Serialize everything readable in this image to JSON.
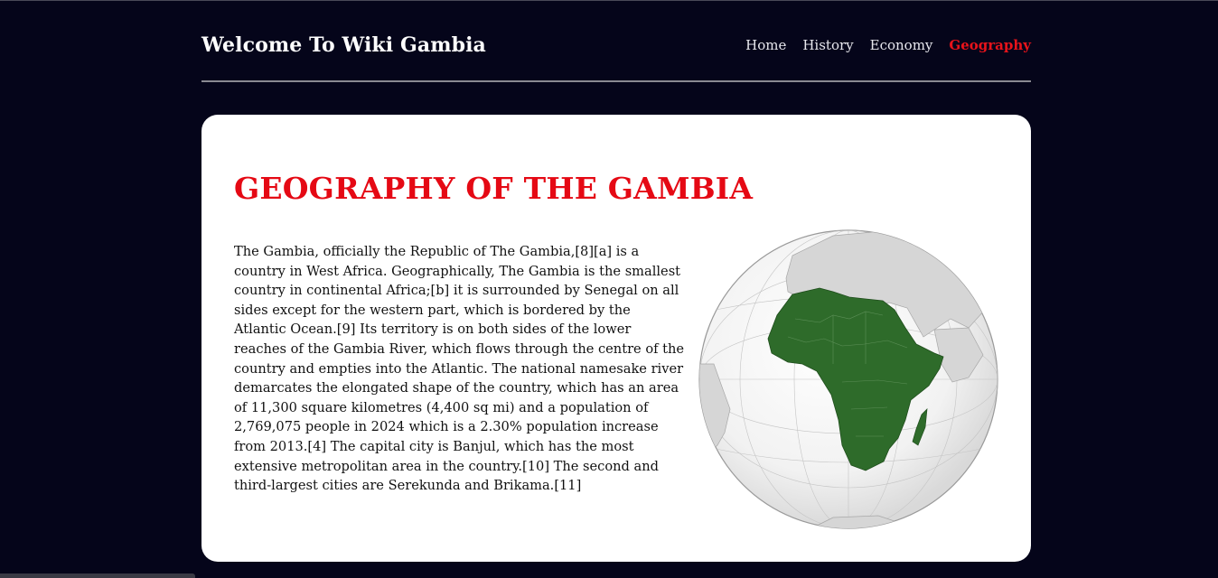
{
  "header": {
    "title": "Welcome To Wiki Gambia",
    "nav": [
      {
        "label": "Home",
        "active": false
      },
      {
        "label": "History",
        "active": false
      },
      {
        "label": "Economy",
        "active": false
      },
      {
        "label": "Geography",
        "active": true
      }
    ]
  },
  "main": {
    "heading": "GEOGRAPHY OF THE GAMBIA",
    "paragraph": "The Gambia, officially the Republic of The Gambia,[8][a] is a country in West Africa. Geographically, The Gambia is the smallest country in continental Africa;[b] it is surrounded by Senegal on all sides except for the western part, which is bordered by the Atlantic Ocean.[9] Its territory is on both sides of the lower reaches of the Gambia River, which flows through the centre of the country and empties into the Atlantic. The national namesake river demarcates the elongated shape of the country, which has an area of 11,300 square kilometres (4,400 sq mi) and a population of 2,769,075 people in 2024 which is a 2.30% population increase from 2013.[4] The capital city is Banjul, which has the most extensive metropolitan area in the country.[10] The second and third-largest cities are Serekunda and Brikama.[11]",
    "image": "orthographic-globe-africa-highlighted"
  },
  "colors": {
    "background": "#05051a",
    "accent": "#e50914",
    "highlight_land": "#2e6b2a",
    "other_land": "#d6d6d6"
  }
}
